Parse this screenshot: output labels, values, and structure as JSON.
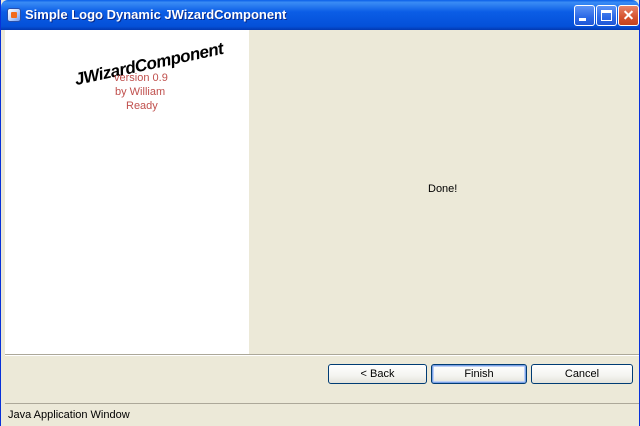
{
  "window": {
    "title": "Simple Logo Dynamic JWizardComponent",
    "icon": "java-app-icon",
    "controls": [
      "minimize",
      "maximize",
      "close"
    ]
  },
  "logo": {
    "title": "JWizardComponent",
    "version": "version 0.9",
    "author": "by William",
    "status": "Ready"
  },
  "content": {
    "message": "Done!"
  },
  "buttons": {
    "back": "< Back",
    "finish": "Finish",
    "cancel": "Cancel"
  },
  "statusbar": {
    "text": "Java Application Window"
  },
  "colors": {
    "titlebar": "#0450d8",
    "panel": "#ece9d8",
    "logo_text": "#c0504d"
  }
}
